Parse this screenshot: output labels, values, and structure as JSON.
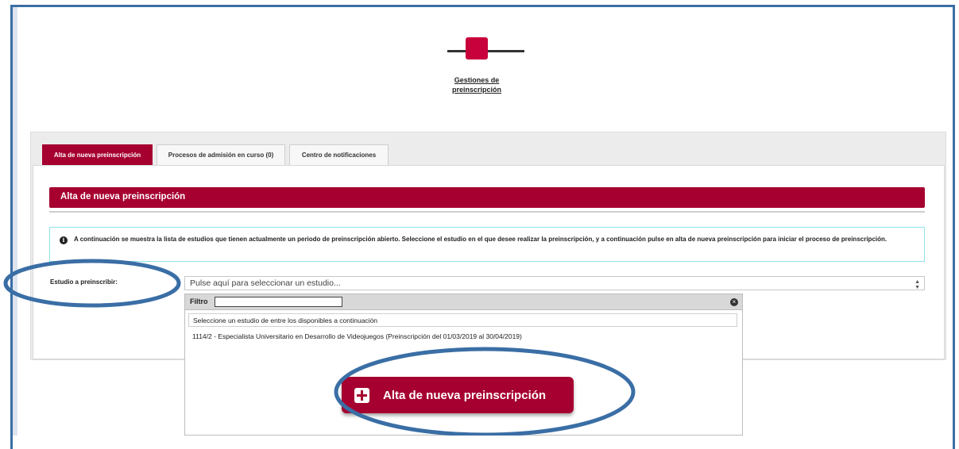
{
  "stepper": {
    "label": "Gestiones de preinscripción",
    "accent": "#c8003c"
  },
  "tabs": [
    {
      "label": "Alta de nueva preinscripción",
      "active": true
    },
    {
      "label": "Procesos de admisión en curso (0)",
      "active": false
    },
    {
      "label": "Centro de notificaciones",
      "active": false
    }
  ],
  "section": {
    "title": "Alta de nueva preinscripción"
  },
  "info": {
    "icon": "info-icon",
    "text": "A continuación se muestra la lista de estudios que tienen actualmente un periodo de preinscripción abierto. Seleccione el estudio en el que desee realizar la preinscripción, y a continuación pulse en alta de nueva preinscripción para iniciar el proceso de preinscripción."
  },
  "form": {
    "field_label": "Estudio a preinscribir:",
    "select_placeholder": "Pulse aquí para seleccionar un estudio..."
  },
  "dropdown": {
    "filter_label": "Filtro",
    "filter_value": "",
    "placeholder_option": "Seleccione un estudio de entre los disponibles a continuación",
    "options": [
      "1114/2 - Especialista Universitario en Desarrollo de Videojuegos (Preinscripción del 01/03/2019 al 30/04/2019)"
    ]
  },
  "button": {
    "label": "Alta de nueva preinscripción",
    "icon": "plus-icon"
  },
  "colors": {
    "brand": "#a60030",
    "annotation": "#3a6ea5",
    "info_border": "#8fe3ea"
  }
}
